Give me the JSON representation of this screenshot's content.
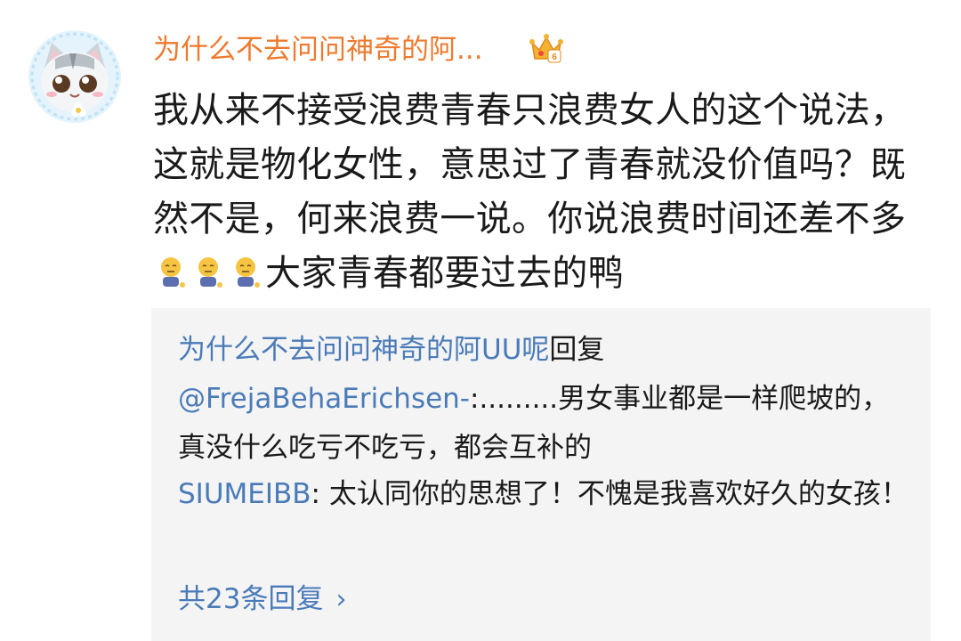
{
  "comment": {
    "avatar_icon": "cat-avatar-icon",
    "username": "为什么不去问问神奇的阿...",
    "crown_badge_icon": "crown-level-6-icon",
    "text_lines": [
      "我从来不接受浪费青春只浪费女人的这个说法，",
      "这就是物化女性，意思过了青春就没价值吗？既",
      "然不是，何来浪费一说。你说浪费时间还差不多"
    ],
    "last_line_emoji": "sweat-sit-emoji",
    "last_line_text": "大家青春都要过去的鸭"
  },
  "replies": [
    {
      "author": "为什么不去问问神奇的阿UU呢",
      "action": "回复",
      "mention": "@FrejaBehaErichsen-",
      "text": ":.........男女事业都是一样爬坡的，真没什么吃亏不吃亏，都会互补的"
    },
    {
      "author": "SIUMEIBB",
      "text": ": 太认同你的思想了！不愧是我喜欢好久的女孩！"
    }
  ],
  "more_replies": "共23条回复",
  "colors": {
    "username": "#ee7a2e",
    "link_blue": "#4a7bb8",
    "reply_bg": "#f4f4f4"
  }
}
